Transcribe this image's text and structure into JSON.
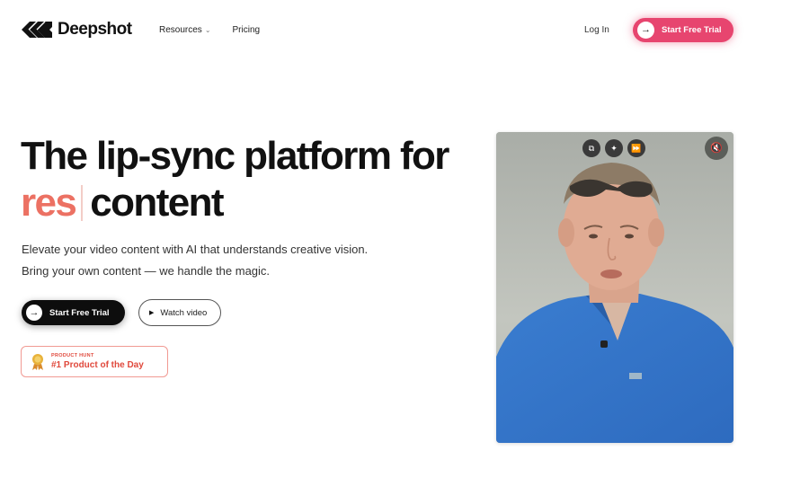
{
  "brand": {
    "name": "Deepshot"
  },
  "nav": {
    "links": [
      {
        "label": "Resources",
        "has_dropdown": true
      },
      {
        "label": "Pricing",
        "has_dropdown": false
      }
    ],
    "login_label": "Log In",
    "cta_label": "Start Free Trial"
  },
  "hero": {
    "headline_line1": "The lip-sync platform for",
    "headline_typed": "res",
    "headline_rest": "content",
    "sub_line1": "Elevate your video content with AI that understands creative vision.",
    "sub_line2": "Bring your own content — we handle the magic.",
    "primary_cta": "Start Free Trial",
    "secondary_cta": "Watch video",
    "badge": {
      "small": "PRODUCT HUNT",
      "main": "#1 Product of the Day"
    }
  },
  "video": {
    "controls": [
      "copy-icon",
      "sparkle-icon",
      "fast-forward-icon"
    ],
    "mute_icon": "mute-icon"
  },
  "colors": {
    "accent_pink": "#e7456f",
    "typed_coral": "#ec7163",
    "badge_red": "#e0493c",
    "dark_button": "#0d0d0d"
  }
}
